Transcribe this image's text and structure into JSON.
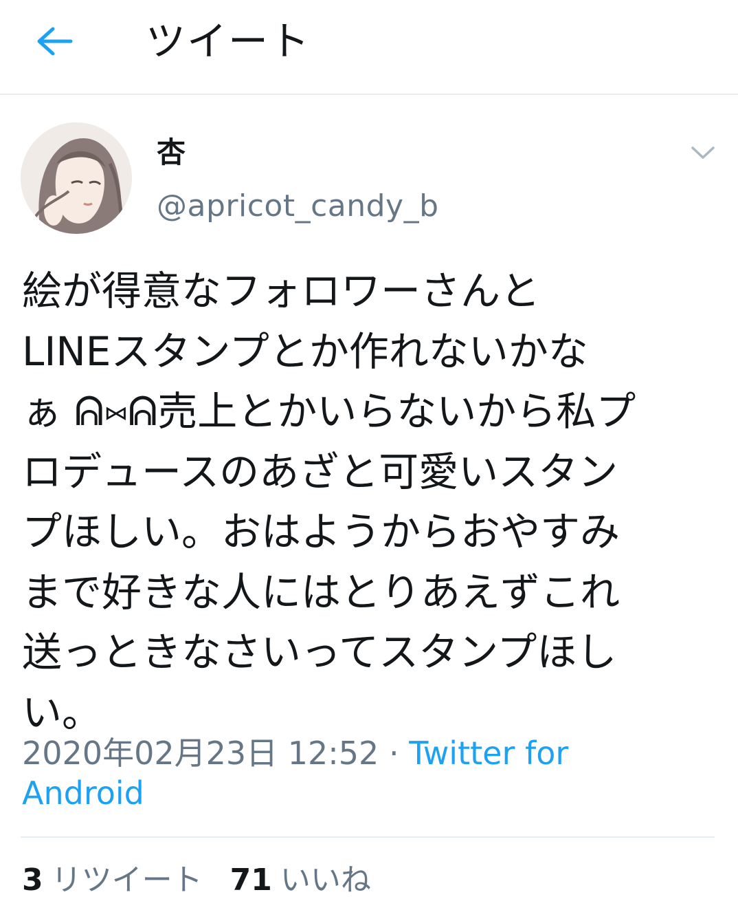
{
  "header": {
    "title": "ツイート",
    "back_icon": "arrow-left-icon",
    "accent": "#1da1f2"
  },
  "tweet": {
    "author": {
      "display_name": "杏",
      "handle": "@apricot_candy_b",
      "avatar_icon": "avatar-illustration"
    },
    "menu_icon": "chevron-down-icon",
    "text_lines": [
      "絵が得意なフォロワーさんと",
      "LINEスタンプとか作れないかな",
      "ぁ ᕱ⑅ᕱ売上とかいらないから私プ",
      "ロデュースのあざと可愛いスタン",
      "プほしい。おはようからおやすみ",
      "まで好きな人にはとりあえずこれ",
      "送っときなさいってスタンプほし",
      "い。"
    ],
    "timestamp": "2020年02月23日 12:52",
    "separator": " · ",
    "source_part1": "Twitter for",
    "source_part2": "Android"
  },
  "stats": {
    "retweets_count": "3",
    "retweets_label": "リツイート",
    "likes_count": "71",
    "likes_label": "いいね"
  }
}
